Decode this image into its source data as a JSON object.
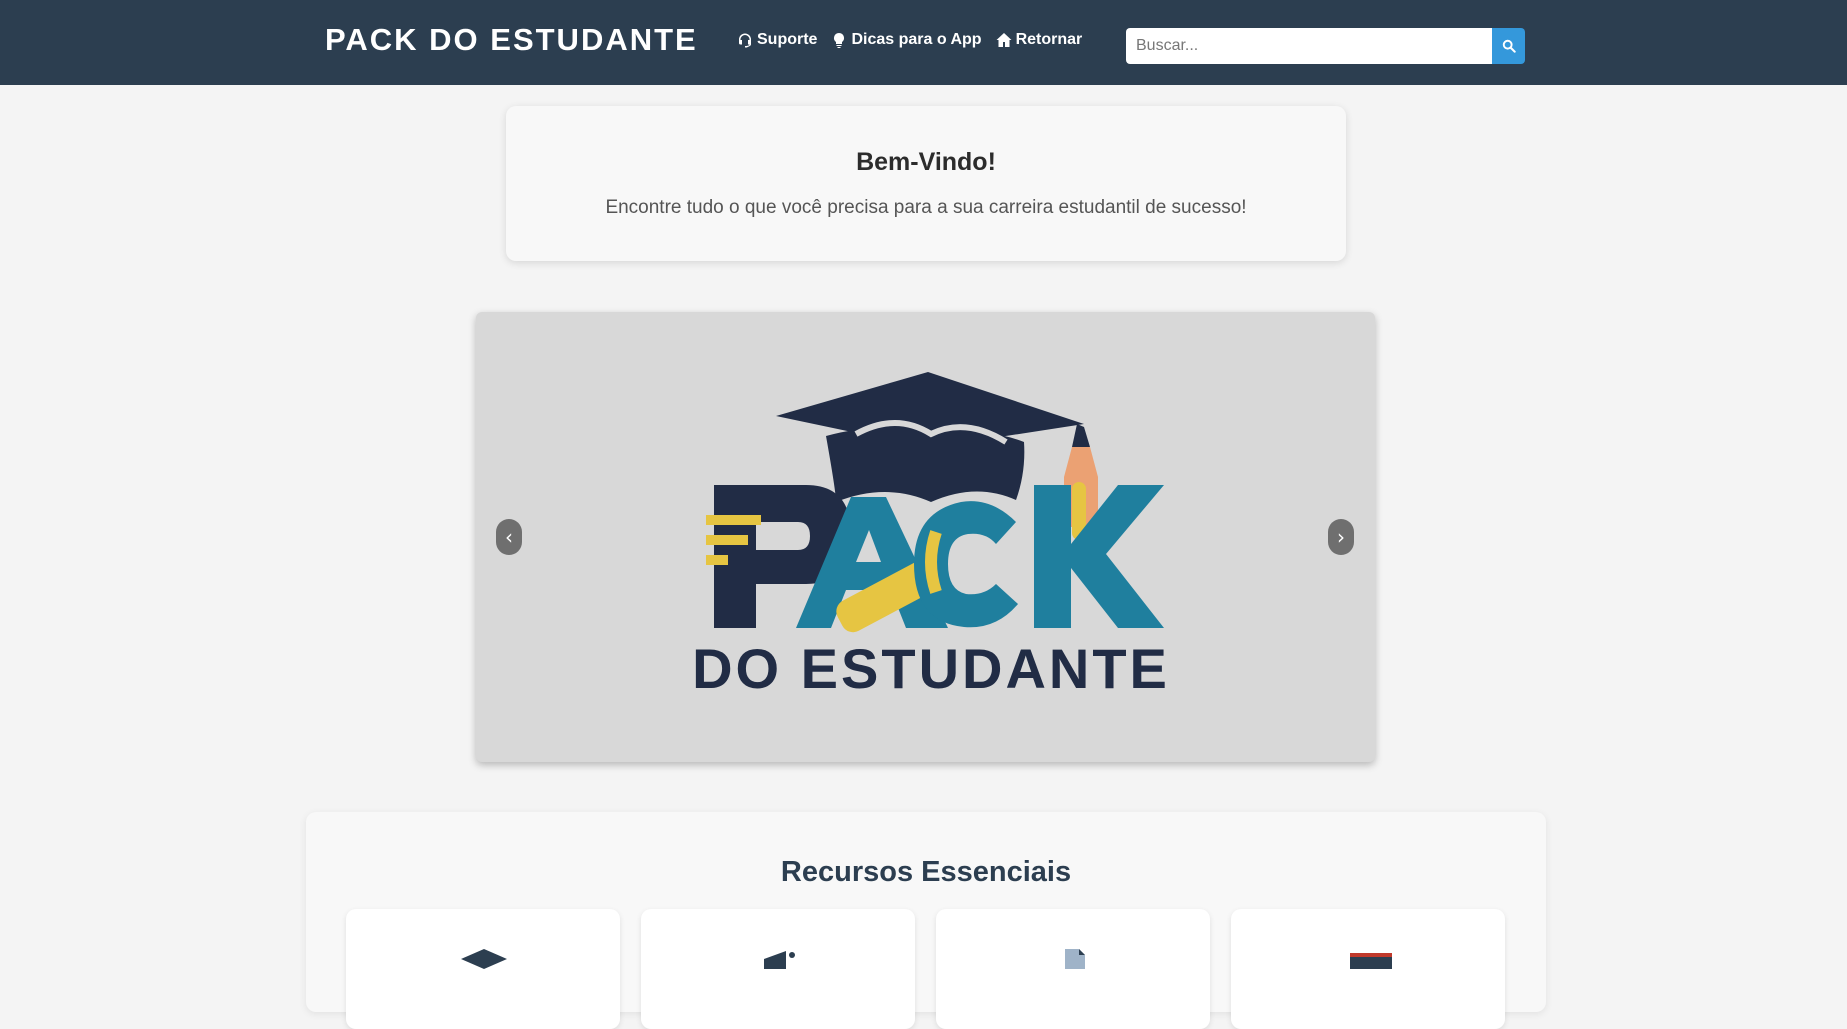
{
  "header": {
    "brand": "PACK DO ESTUDANTE",
    "nav": [
      {
        "label": "Suporte",
        "icon": "headset-icon"
      },
      {
        "label": "Dicas para o App",
        "icon": "lightbulb-icon"
      },
      {
        "label": "Retornar",
        "icon": "home-icon"
      }
    ],
    "search": {
      "placeholder": "Buscar...",
      "value": "",
      "button_icon": "search-icon"
    }
  },
  "welcome": {
    "title": "Bem-Vindo!",
    "subtitle": "Encontre tudo o que você precisa para a sua carreira estudantil de sucesso!"
  },
  "carousel": {
    "prev_label": "‹",
    "next_label": "›",
    "slide_logo": {
      "word1": "PACK",
      "word2": "DO ESTUDANTE"
    }
  },
  "resources": {
    "title": "Recursos Essenciais",
    "cards": [
      {
        "icon": "graduation-cap-icon"
      },
      {
        "icon": "megaphone-icon"
      },
      {
        "icon": "document-icon"
      },
      {
        "icon": "book-icon"
      }
    ]
  },
  "colors": {
    "header_bg": "#2c3e50",
    "accent": "#3498db",
    "logo_navy": "#212c45",
    "logo_teal": "#1f7f9e",
    "logo_yellow": "#e6c542",
    "logo_orange": "#eba173"
  }
}
